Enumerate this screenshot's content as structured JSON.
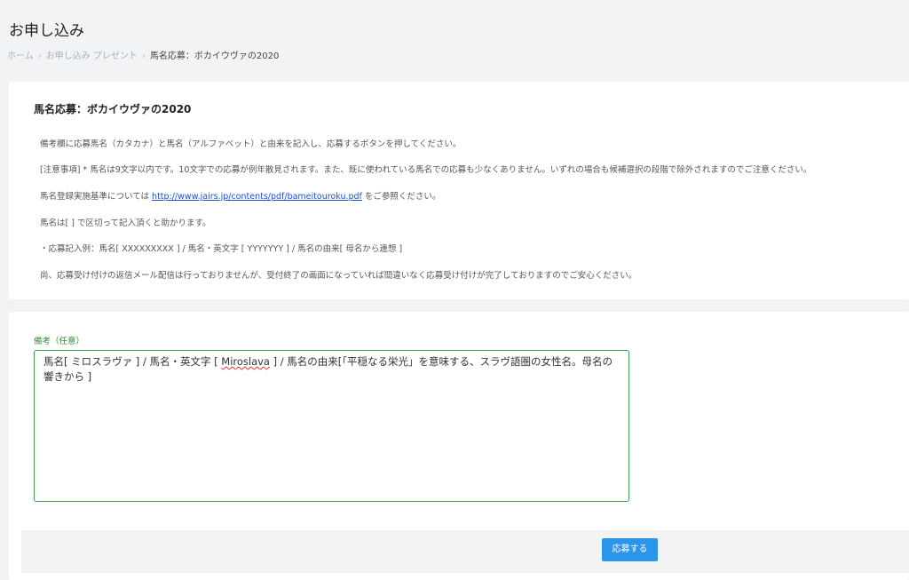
{
  "header": {
    "title": "お申し込み"
  },
  "breadcrumb": {
    "items": [
      "ホーム",
      "お申し込み プレゼント",
      "馬名応募：ボカイウヴァの2020"
    ],
    "separator": "›"
  },
  "info": {
    "heading": "馬名応募：ボカイウヴァの2020",
    "line1": "備考欄に応募馬名（カタカナ）と馬名（アルファベット）と由来を記入し、応募するボタンを押してください。",
    "line2": "[注意事項] * 馬名は9文字以内です。10文字での応募が例年散見されます。また、既に使われている馬名での応募も少なくありません。いずれの場合も候補選択の段階で除外されますのでご注意ください。",
    "line3_prefix": "馬名登録実施基準については ",
    "line3_link": "http://www.jairs.jp/contents/pdf/bameitouroku.pdf",
    "line3_suffix": " をご参照ください。",
    "line4": "馬名は[ ] で区切って記入頂くと助かります。",
    "line5": "・応募記入例：馬名[ XXXXXXXXX ] / 馬名・英文字 [ YYYYYYY ] / 馬名の由来[ 母名から連想 ]",
    "line6": "尚、応募受け付けの返信メール配信は行っておりませんが、受付終了の画面になっていれば間違いなく応募受け付けが完了しておりますのでご安心ください。"
  },
  "form": {
    "field_label": "備考（任意）",
    "textarea_value_part1": "馬名[ ミロスラヴァ ] / 馬名・英文字 [ ",
    "textarea_value_misspelled": "Miroslava",
    "textarea_value_part2": " ] / 馬名の由来[「平穏なる栄光」を意味する、スラヴ語圏の女性名。母名の響きから ]",
    "submit_label": "応募する"
  },
  "colors": {
    "accent": "#2b95e9",
    "field_border": "#3e9b4f",
    "link": "#1a4fd6"
  }
}
